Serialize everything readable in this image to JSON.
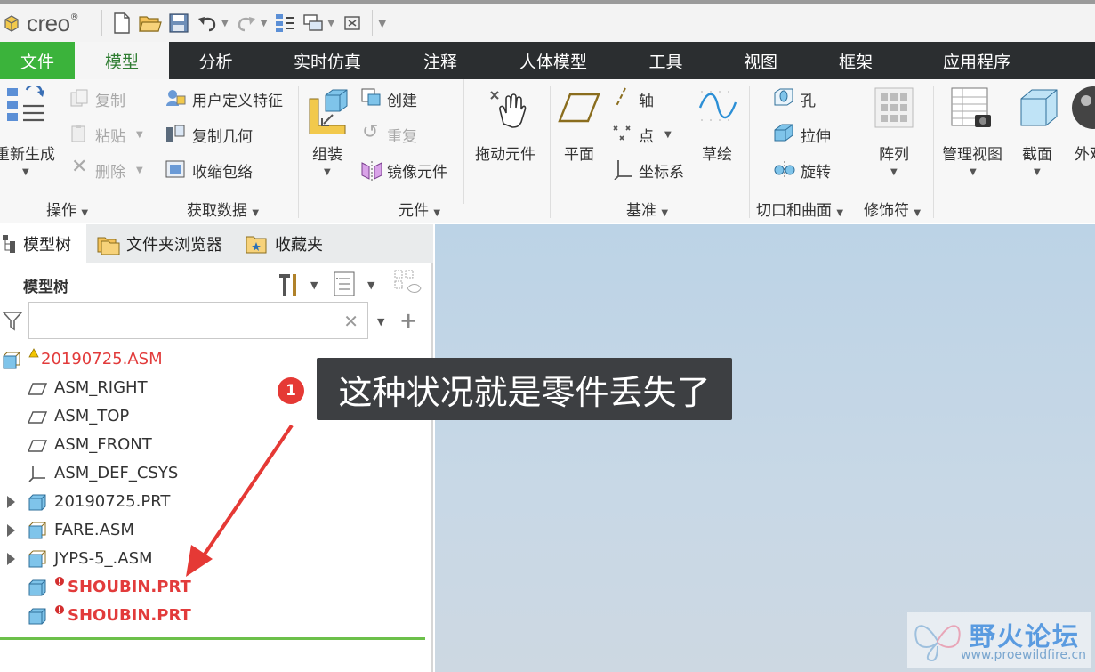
{
  "app": {
    "logo_text": "creo"
  },
  "menu": {
    "tabs": [
      "文件",
      "模型",
      "分析",
      "实时仿真",
      "注释",
      "人体模型",
      "工具",
      "视图",
      "框架",
      "应用程序"
    ]
  },
  "ribbon": {
    "operations": {
      "regenerate": "重新生成",
      "copy": "复制",
      "paste": "粘贴",
      "delete": "删除",
      "group": "操作"
    },
    "get_data": {
      "udf": "用户定义特征",
      "copy_geom": "复制几何",
      "shrinkwrap": "收缩包络",
      "group": "获取数据"
    },
    "component": {
      "assemble": "组装",
      "create": "创建",
      "repeat": "重复",
      "mirror": "镜像元件",
      "drag": "拖动元件",
      "group": "元件"
    },
    "datum": {
      "plane": "平面",
      "axis": "轴",
      "point": "点",
      "csys": "坐标系",
      "sketch": "草绘",
      "group": "基准"
    },
    "cut_surface": {
      "hole": "孔",
      "extrude": "拉伸",
      "revolve": "旋转",
      "group": "切口和曲面"
    },
    "modifiers": {
      "pattern": "阵列",
      "group": "修饰符"
    },
    "view": {
      "manage_views": "管理视图",
      "section": "截面",
      "appearance": "外观"
    }
  },
  "panel": {
    "tabs": [
      "模型树",
      "文件夹浏览器",
      "收藏夹"
    ],
    "title": "模型树",
    "search": {
      "value": ""
    },
    "tree": [
      {
        "label": "20190725.ASM",
        "state": "warning"
      },
      {
        "label": "ASM_RIGHT",
        "state": "normal"
      },
      {
        "label": "ASM_TOP",
        "state": "normal"
      },
      {
        "label": "ASM_FRONT",
        "state": "normal"
      },
      {
        "label": "ASM_DEF_CSYS",
        "state": "normal"
      },
      {
        "label": "20190725.PRT",
        "state": "normal"
      },
      {
        "label": "FARE.ASM",
        "state": "normal"
      },
      {
        "label": "JYPS-5_.ASM",
        "state": "normal"
      },
      {
        "label": "SHOUBIN.PRT",
        "state": "error"
      },
      {
        "label": "SHOUBIN.PRT",
        "state": "error"
      }
    ]
  },
  "annotation": {
    "badge": "1",
    "text": "这种状况就是零件丢失了",
    "color": "#e53935"
  },
  "watermark": {
    "title": "野火论坛",
    "url": "www.proewildfire.cn"
  }
}
